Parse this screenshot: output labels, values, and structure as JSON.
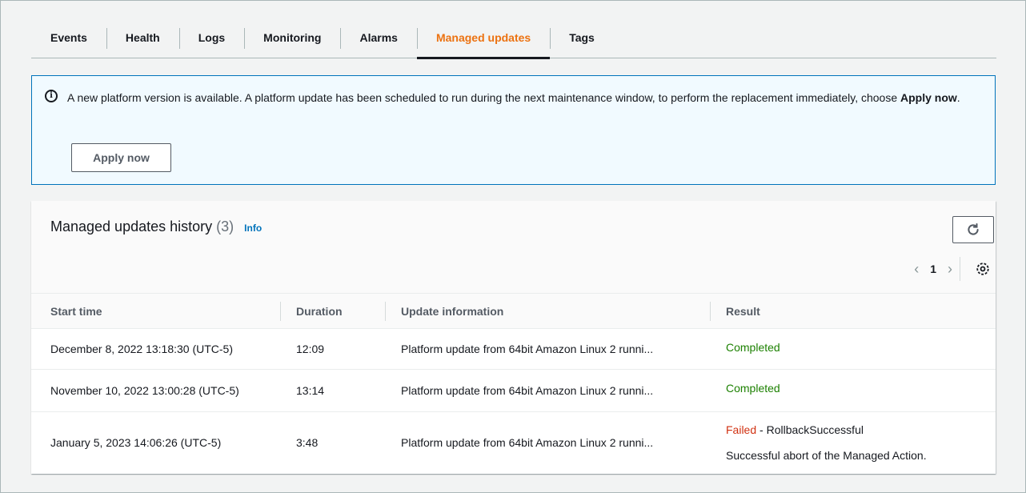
{
  "tabs": [
    {
      "label": "Events"
    },
    {
      "label": "Health"
    },
    {
      "label": "Logs"
    },
    {
      "label": "Monitoring"
    },
    {
      "label": "Alarms"
    },
    {
      "label": "Managed updates",
      "active": true
    },
    {
      "label": "Tags"
    }
  ],
  "alert": {
    "icon": "info-icon",
    "text_before": "A new platform version is available. A platform update has been scheduled to run during the next maintenance window, to perform the replacement immediately, choose ",
    "text_bold": "Apply now",
    "text_after": ".",
    "button_label": "Apply now"
  },
  "history": {
    "title": "Managed updates history",
    "count": "(3)",
    "info_label": "Info",
    "refresh_icon": "refresh-icon",
    "pagination": {
      "current_page": "1"
    },
    "settings_icon": "gear-icon",
    "columns": [
      "Start time",
      "Duration",
      "Update information",
      "Result"
    ],
    "rows": [
      {
        "start_time": "December 8, 2022 13:18:30 (UTC-5)",
        "duration": "12:09",
        "update_info": "Platform update from 64bit Amazon Linux 2 runni...",
        "result_status": "Completed",
        "result_detail": "",
        "result_extra": ""
      },
      {
        "start_time": "November 10, 2022 13:00:28 (UTC-5)",
        "duration": "13:14",
        "update_info": "Platform update from 64bit Amazon Linux 2 runni...",
        "result_status": "Completed",
        "result_detail": "",
        "result_extra": ""
      },
      {
        "start_time": "January 5, 2023 14:06:26 (UTC-5)",
        "duration": "3:48",
        "update_info": "Platform update from 64bit Amazon Linux 2 runni...",
        "result_status": "Failed",
        "result_detail": " - RollbackSuccessful",
        "result_extra": "Successful abort of the Managed Action."
      }
    ]
  },
  "colors": {
    "accent": "#ec7211",
    "link": "#0073bb",
    "success": "#1d8102",
    "error": "#d13212",
    "alert_bg": "#f1faff"
  }
}
